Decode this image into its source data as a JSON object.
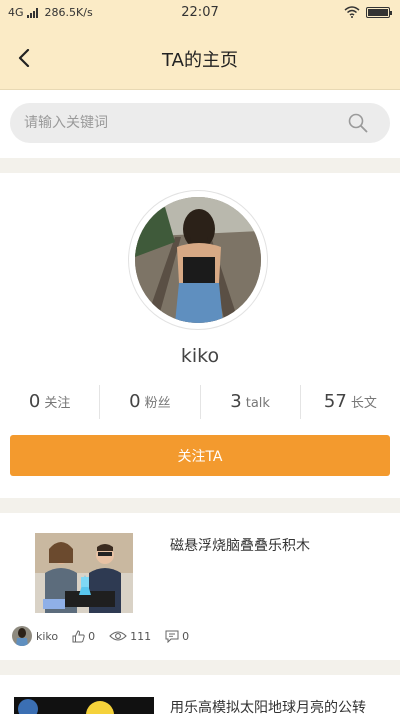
{
  "status_bar": {
    "network": "4G",
    "speed": "286.5K/s",
    "time": "22:07"
  },
  "nav": {
    "title": "TA的主页",
    "back_icon": "chevron-left-icon"
  },
  "search": {
    "placeholder": "请输入关键词",
    "value": "",
    "icon": "search-icon"
  },
  "profile": {
    "username": "kiko",
    "stats": [
      {
        "value": "0",
        "label": "关注"
      },
      {
        "value": "0",
        "label": "粉丝"
      },
      {
        "value": "3",
        "label": "talk"
      },
      {
        "value": "57",
        "label": "长文"
      }
    ],
    "follow_button": "关注TA"
  },
  "posts": [
    {
      "title": "磁悬浮烧脑叠叠乐积木",
      "author": "kiko",
      "likes": "0",
      "views": "111",
      "comments": "0"
    },
    {
      "title": "用乐高模拟太阳地球月亮的公转"
    }
  ],
  "colors": {
    "header_bg": "#fbebc6",
    "accent": "#f39a2e",
    "page_bg": "#f3f1eb"
  }
}
